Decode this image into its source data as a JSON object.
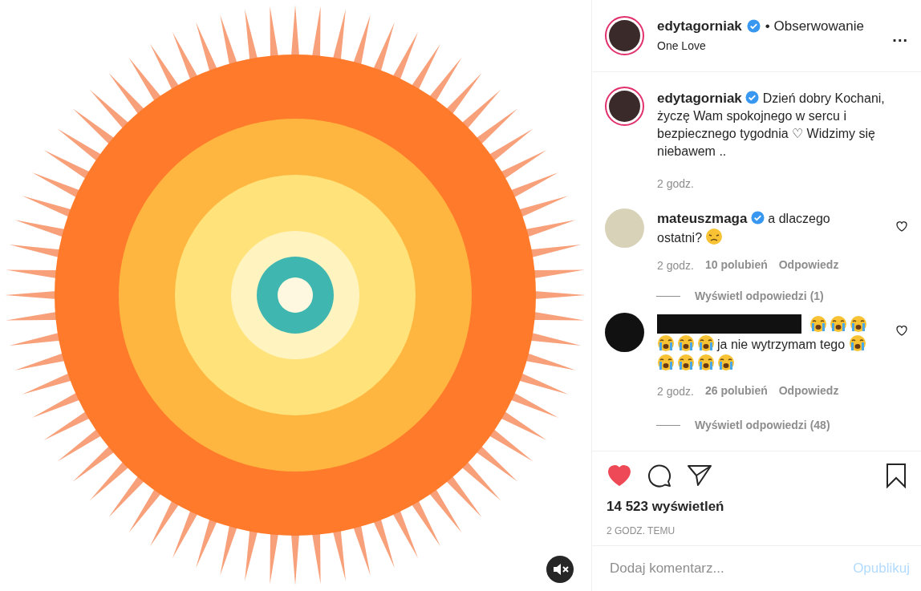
{
  "post": {
    "media": {
      "kind": "picture",
      "muted": true
    },
    "header": {
      "username": "edytagorniak",
      "verified": true,
      "follow": "• Obserwowanie",
      "location": "One Love",
      "more": "..."
    },
    "caption": {
      "username": "edytagorniak",
      "verified": true,
      "text": "Dzień dobry Kochani, życzę Wam spokojnego w sercu i bezpiecznego tygodnia ♡ Widzimy się niebawem ..",
      "time": "2 godz."
    },
    "comments": [
      {
        "username": "mateuszmaga",
        "username_redacted": false,
        "verified": true,
        "liked": false,
        "parts": [
          {
            "kind": "text",
            "text": "a dlaczego ostatni?"
          },
          {
            "kind": "sad-emoji"
          }
        ],
        "time": "2 godz.",
        "likes": "10 polubień",
        "reply": "Odpowiedz",
        "view_replies": "Wyświetl odpowiedzi (1)"
      },
      {
        "username_redacted": true,
        "verified": false,
        "liked": false,
        "parts": [
          {
            "kind": "crying-emoji"
          },
          {
            "kind": "crying-emoji"
          },
          {
            "kind": "crying-emoji"
          },
          {
            "kind": "crying-emoji"
          },
          {
            "kind": "crying-emoji"
          },
          {
            "kind": "crying-emoji"
          },
          {
            "kind": "text",
            "text": "ja nie wytrzymam tego"
          },
          {
            "kind": "crying-emoji"
          },
          {
            "kind": "crying-emoji"
          },
          {
            "kind": "crying-emoji"
          },
          {
            "kind": "crying-emoji"
          },
          {
            "kind": "crying-emoji"
          }
        ],
        "time": "2 godz.",
        "likes": "26 polubień",
        "reply": "Odpowiedz",
        "view_replies": "Wyświetl odpowiedzi (48)"
      }
    ],
    "actions": {
      "liked": true,
      "saved": false
    },
    "views": "14 523 wyświetleń",
    "posted": "2 GODZ. TEMU",
    "add_comment": {
      "placeholder": "Dodaj komentarz...",
      "submit": "Opublikuj"
    }
  }
}
